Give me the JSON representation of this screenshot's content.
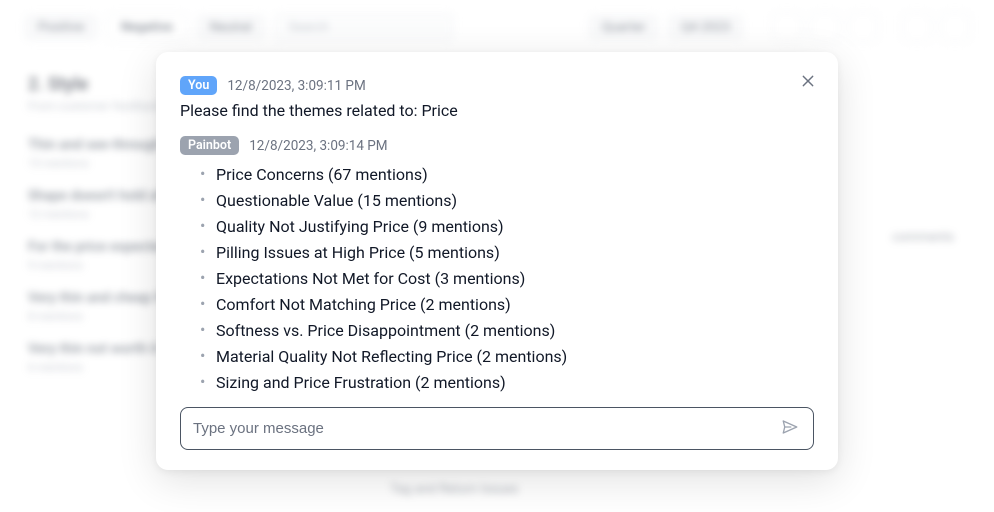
{
  "bg": {
    "tabs": [
      "Positive",
      "Negative",
      "Neutral"
    ],
    "search": "Search",
    "filter1": "Quarter",
    "filter2": "Q4 2023",
    "heading": "2. Style",
    "sub": "From customer feedback",
    "cards": [
      {
        "title": "Thin and see-through",
        "sub": "15 mentions"
      },
      {
        "title": "Shape doesn't hold after wash",
        "sub": "12 mentions"
      },
      {
        "title": "For the price expected better",
        "sub": "9 mentions"
      },
      {
        "title": "Very thin and cheap feel",
        "sub": "8 mentions"
      },
      {
        "title": "Very thin not worth it",
        "sub": "6 mentions"
      }
    ],
    "right": "comments",
    "center": "Tag and Return Issues"
  },
  "modal": {
    "user": {
      "badge": "You",
      "time": "12/8/2023, 3:09:11 PM",
      "text": "Please find the themes related to: Price"
    },
    "bot": {
      "badge": "Painbot",
      "time": "12/8/2023, 3:09:14 PM",
      "themes": [
        "Price Concerns (67 mentions)",
        "Questionable Value (15 mentions)",
        "Quality Not Justifying Price (9 mentions)",
        "Pilling Issues at High Price (5 mentions)",
        "Expectations Not Met for Cost (3 mentions)",
        "Comfort Not Matching Price (2 mentions)",
        "Softness vs. Price Disappointment (2 mentions)",
        "Material Quality Not Reflecting Price (2 mentions)",
        "Sizing and Price Frustration (2 mentions)"
      ]
    },
    "input_placeholder": "Type your message"
  }
}
